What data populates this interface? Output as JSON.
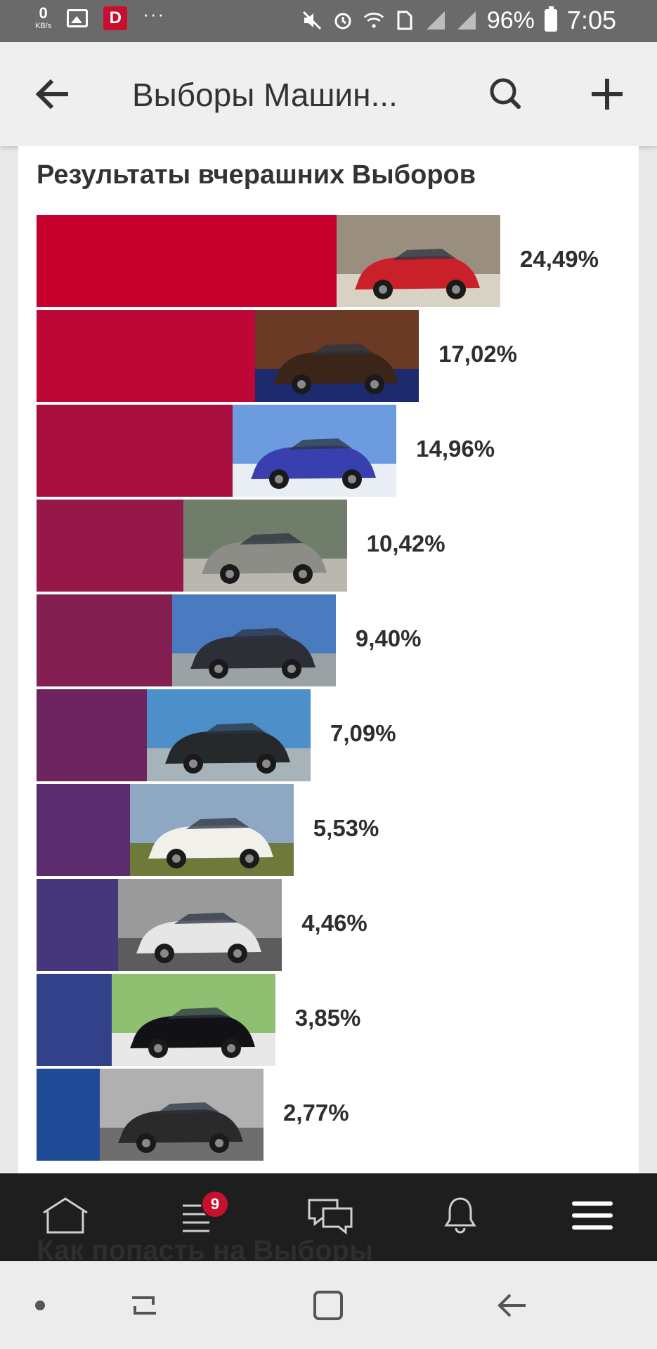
{
  "status_bar": {
    "speed_value": "0",
    "speed_unit": "KB/s",
    "notification_app_letter": "D",
    "more": "···",
    "battery": "96%",
    "time": "7:05"
  },
  "app_bar": {
    "title": "Выборы Машин..."
  },
  "results": {
    "title": "Результаты вчерашних Выборов",
    "items": [
      {
        "percent": "24,49%",
        "value": 24.49,
        "color": "#c8002d"
      },
      {
        "percent": "17,02%",
        "value": 17.02,
        "color": "#bd0736"
      },
      {
        "percent": "14,96%",
        "value": 14.96,
        "color": "#a90e3f"
      },
      {
        "percent": "10,42%",
        "value": 10.42,
        "color": "#951848"
      },
      {
        "percent": "9,40%",
        "value": 9.4,
        "color": "#841f52"
      },
      {
        "percent": "7,09%",
        "value": 7.09,
        "color": "#6d245f"
      },
      {
        "percent": "5,53%",
        "value": 5.53,
        "color": "#5b2c6e"
      },
      {
        "percent": "4,46%",
        "value": 4.46,
        "color": "#46377c"
      },
      {
        "percent": "3,85%",
        "value": 3.85,
        "color": "#33408a"
      },
      {
        "percent": "2,77%",
        "value": 2.77,
        "color": "#1f4a96"
      }
    ]
  },
  "next_section_peek": "Как попасть на Выборы",
  "bottom_nav": {
    "feed_badge": "9"
  }
}
